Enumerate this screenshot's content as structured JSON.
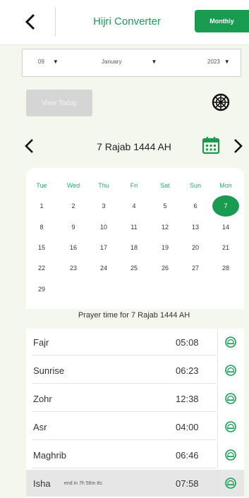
{
  "header": {
    "title": "Hijri Converter",
    "monthly_label": "Monthly"
  },
  "selector": {
    "day": "09",
    "month": "January",
    "year": "2023"
  },
  "view_today_label": "View Today",
  "current_date": "7 Rajab 1444 AH",
  "calendar": {
    "weekdays": [
      "Tue",
      "Wed",
      "Thu",
      "Fri",
      "Sat",
      "Sun",
      "Mon"
    ],
    "weeks": [
      [
        "1",
        "2",
        "3",
        "4",
        "5",
        "6",
        "7"
      ],
      [
        "8",
        "9",
        "10",
        "11",
        "12",
        "13",
        "14"
      ],
      [
        "15",
        "16",
        "17",
        "18",
        "19",
        "20",
        "21"
      ],
      [
        "22",
        "23",
        "24",
        "25",
        "26",
        "27",
        "28"
      ],
      [
        "29"
      ]
    ],
    "selected_day": "7"
  },
  "prayer_heading": "Prayer time for 7 Rajab 1444 AH",
  "prayers": [
    {
      "name": "Fajr",
      "time": "05:08",
      "countdown": ""
    },
    {
      "name": "Sunrise",
      "time": "06:23",
      "countdown": ""
    },
    {
      "name": "Zohr",
      "time": "12:38",
      "countdown": ""
    },
    {
      "name": "Asr",
      "time": "04:00",
      "countdown": ""
    },
    {
      "name": "Maghrib",
      "time": "06:46",
      "countdown": ""
    },
    {
      "name": "Isha",
      "time": "07:58",
      "countdown": "end in 7h 56m 8s"
    }
  ],
  "colors": {
    "accent": "#1a9b52",
    "weekday": "#2aa676",
    "background": "#f3f7ee"
  },
  "icons": {
    "back": "chevron-left-icon",
    "wheel": "wheel-icon",
    "calendar": "calendar-icon",
    "bell": "bell-icon"
  }
}
